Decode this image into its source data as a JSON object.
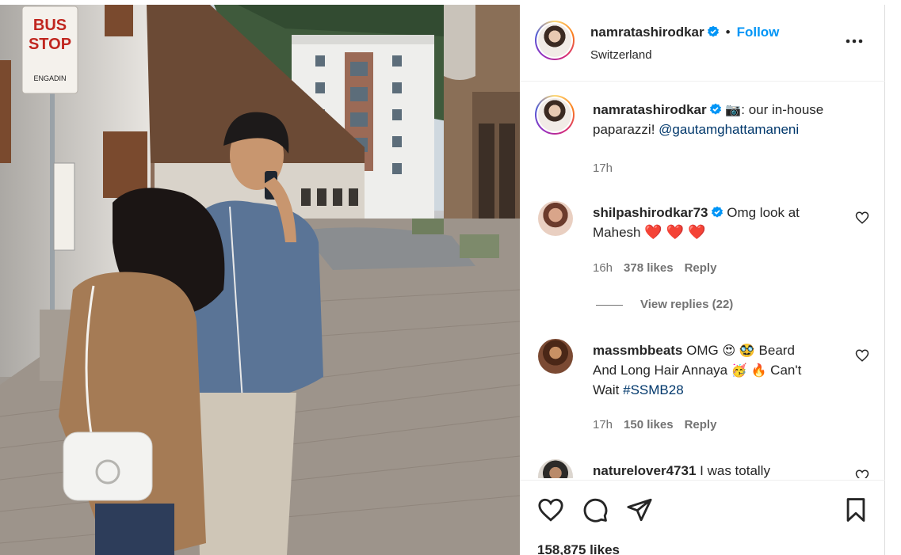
{
  "photo": {
    "sign_top": "BUS",
    "sign_bottom": "STOP",
    "sign_sub": "ENGADIN"
  },
  "header": {
    "username": "namratashirodkar",
    "separator": "•",
    "follow_label": "Follow",
    "location": "Switzerland",
    "more_label": "•••"
  },
  "caption": {
    "username": "namratashirodkar",
    "camera": "📷",
    "text": ": our in-house",
    "text2": "paparazzi!",
    "mention": "@gautamghattamaneni",
    "time": "17h"
  },
  "comments": [
    {
      "username": "shilpashirodkar73",
      "text": "Omg look at",
      "text2": "Mahesh",
      "hearts": "❤️ ❤️ ❤️",
      "time": "16h",
      "likes": "378 likes",
      "reply": "Reply",
      "view_replies": "View replies (22)"
    },
    {
      "username": "massmbbeats",
      "text": "OMG",
      "emoji1": "😍",
      "emoji2": "🥸",
      "text_b": "Beard",
      "text2": "And Long Hair Annaya",
      "emoji3": "🥳",
      "emoji4": "🔥",
      "text2b": "Can't",
      "text3": "Wait",
      "hashtag": "#SSMB28",
      "time": "17h",
      "likes": "150 likes",
      "reply": "Reply"
    },
    {
      "username": "naturelover4731",
      "text": "I was totally"
    }
  ],
  "footer": {
    "likes": "158,875 likes"
  },
  "colors": {
    "accent": "#0095f6",
    "verified": "#0095f6",
    "text": "#262626",
    "muted": "#737373"
  }
}
